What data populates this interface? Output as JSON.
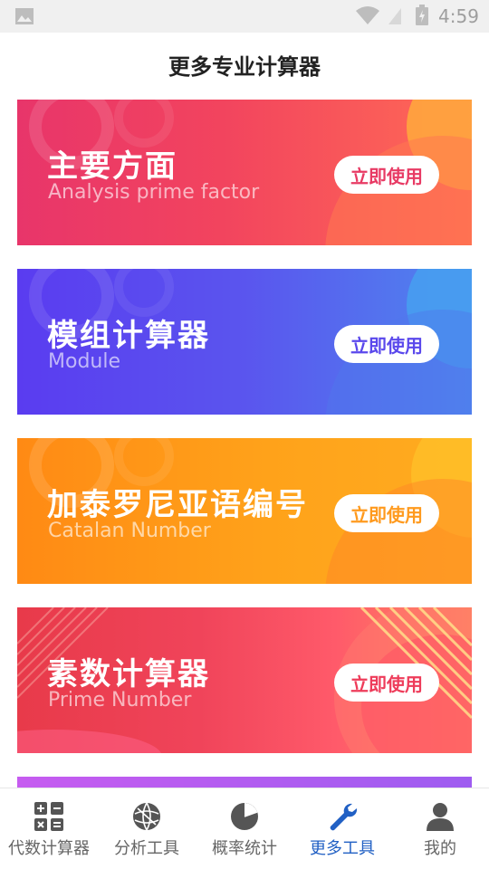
{
  "status_bar": {
    "time": "4:59",
    "icons": [
      "image-icon",
      "wifi-icon",
      "signal-icon",
      "battery-icon"
    ]
  },
  "header": {
    "title": "更多专业计算器"
  },
  "cards": [
    {
      "title": "主要方面",
      "subtitle": "Analysis prime factor",
      "button": "立即使用",
      "button_color": "#e83a64"
    },
    {
      "title": "模组计算器",
      "subtitle": "Module",
      "button": "立即使用",
      "button_color": "#5a48ec"
    },
    {
      "title": "加泰罗尼亚语编号",
      "subtitle": "Catalan  Number",
      "button": "立即使用",
      "button_color": "#ff9a1e"
    },
    {
      "title": "素数计算器",
      "subtitle": "Prime Number",
      "button": "立即使用",
      "button_color": "#ee3c5a"
    }
  ],
  "bottom_nav": {
    "items": [
      {
        "label": "代数计算器",
        "icon": "calculator-icon",
        "active": false
      },
      {
        "label": "分析工具",
        "icon": "globe-icon",
        "active": false
      },
      {
        "label": "概率统计",
        "icon": "pie-chart-icon",
        "active": false
      },
      {
        "label": "更多工具",
        "icon": "wrench-icon",
        "active": true
      },
      {
        "label": "我的",
        "icon": "user-icon",
        "active": false
      }
    ],
    "active_color": "#2160c4",
    "inactive_color": "#666666"
  }
}
